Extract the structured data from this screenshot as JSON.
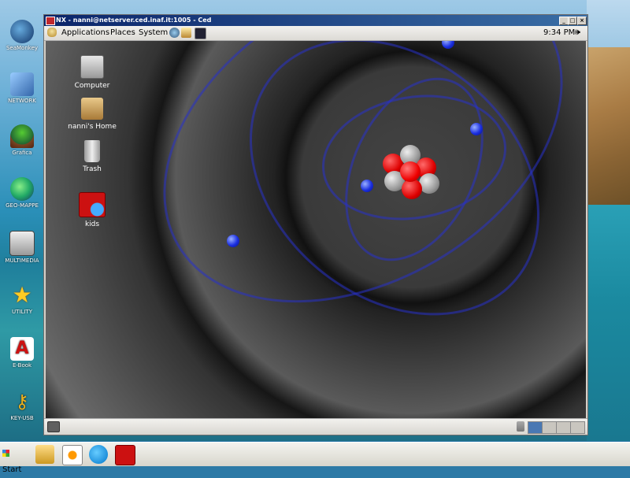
{
  "window": {
    "title": "NX - nanni@netserver.ced.inaf.it:1005 - Ced",
    "minimize_glyph": "_",
    "maximize_glyph": "□",
    "close_glyph": "×"
  },
  "gnome_panel": {
    "menus": [
      "Applications",
      "Places",
      "System"
    ],
    "clock": "9:34 PM"
  },
  "gnome_desktop_icons": [
    {
      "label": "Computer",
      "icon": "computer-icon"
    },
    {
      "label": "nanni's Home",
      "icon": "home-folder-icon"
    },
    {
      "label": "Trash",
      "icon": "trash-icon"
    },
    {
      "label": "kids",
      "icon": "kids-app-icon"
    }
  ],
  "windows_desktop_icons": [
    {
      "label": "SeaMonkey",
      "icon": "seamonkey-icon"
    },
    {
      "label": "NETWORK",
      "icon": "network-icon"
    },
    {
      "label": "Grafica",
      "icon": "tree-icon"
    },
    {
      "label": "GEO-MAPPE",
      "icon": "globe-icon"
    },
    {
      "label": "MULTIMEDIA",
      "icon": "camera-icon"
    },
    {
      "label": "UTILITY",
      "icon": "star-icon"
    },
    {
      "label": "E-Book",
      "icon": "acrobat-icon"
    },
    {
      "label": "KEY-USB",
      "icon": "key-icon"
    }
  ],
  "taskbar": {
    "start_label": "Start"
  },
  "colors": {
    "titlebar": "#0a246a",
    "electron": "#1a2ee0",
    "nucleus_red": "#e01010",
    "nucleus_gray": "#9a9a9a"
  }
}
